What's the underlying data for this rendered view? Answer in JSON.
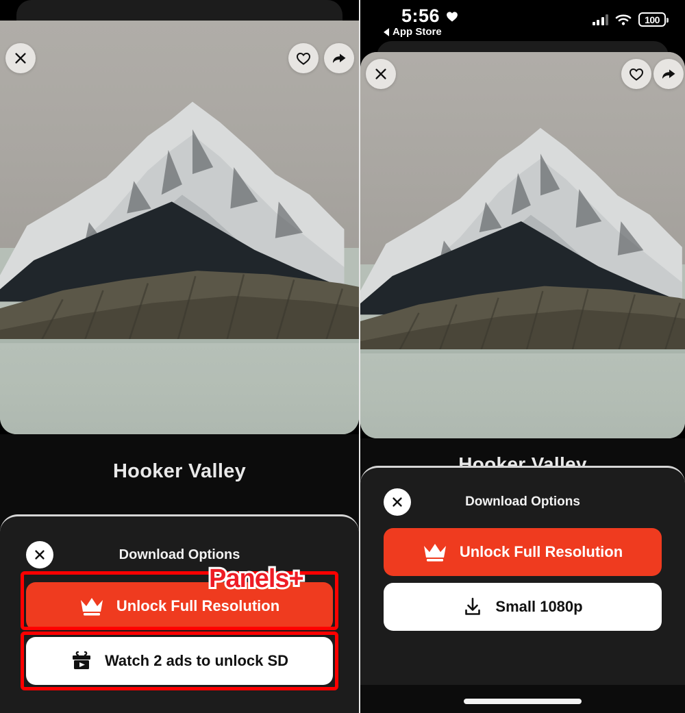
{
  "status_bar": {
    "time": "5:56",
    "heart_icon": "heart-filled-icon",
    "back_label": "App Store",
    "signal_icon": "cellular-signal-icon",
    "wifi_icon": "wifi-icon",
    "battery_level": "100"
  },
  "photo": {
    "alt": "Hooker Valley snow mountain wallpaper",
    "close_icon": "close-icon",
    "favorite_icon": "heart-outline-icon",
    "share_icon": "share-arrow-icon"
  },
  "wallpaper": {
    "title": "Hooker Valley"
  },
  "sheet": {
    "close_icon": "close-icon",
    "title": "Download Options",
    "options_left": [
      {
        "label": "Unlock Full Resolution",
        "icon": "crown-icon",
        "style": "primary"
      },
      {
        "label": "Watch 2 ads to unlock SD",
        "icon": "gift-video-icon",
        "style": "secondary"
      }
    ],
    "options_right": [
      {
        "label": "Unlock Full Resolution",
        "icon": "crown-icon",
        "style": "primary"
      },
      {
        "label": "Small 1080p",
        "icon": "download-icon",
        "style": "secondary"
      }
    ]
  },
  "annotation": {
    "badge_text": "Panels+",
    "highlight_color": "#ff0000"
  },
  "colors": {
    "accent_red": "#ef3b1f",
    "sheet_bg": "#1c1c1c",
    "page_bg": "#0c0c0c",
    "button_white": "#ffffff"
  }
}
